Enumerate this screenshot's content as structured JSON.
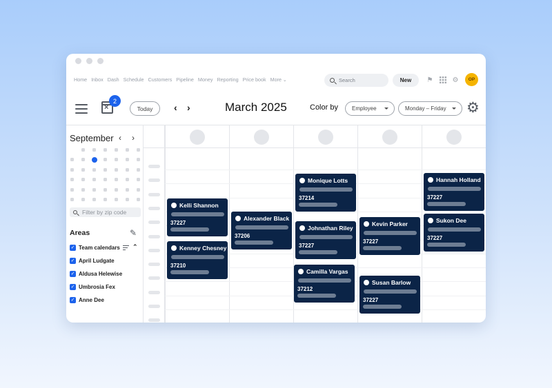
{
  "nav": {
    "items": [
      "Home",
      "Inbox",
      "Dash",
      "Schedule",
      "Customers",
      "Pipeline",
      "Money",
      "Reporting",
      "Price book"
    ],
    "more_label": "More"
  },
  "search": {
    "placeholder": "Search"
  },
  "new_button": {
    "label": "New"
  },
  "user": {
    "initials": "OP",
    "avatar_color": "#f5b400"
  },
  "notification": {
    "count": "2"
  },
  "toolbar": {
    "today_label": "Today",
    "month_title": "March 2025",
    "color_by_label": "Color by",
    "color_by_value": "Employee",
    "range_value": "Monday – Friday"
  },
  "mini_calendar": {
    "month": "September",
    "selected_color": "#1d63ec"
  },
  "filter": {
    "placeholder": "Filter by zip code"
  },
  "areas": {
    "title": "Areas",
    "items": [
      "Team calendars",
      "April Ludgate",
      "Aldusa Helewise",
      "Umbrosia Fex",
      "Anne Dee"
    ]
  },
  "colors": {
    "event_bg": "#0b2447",
    "accent": "#1d63ec"
  },
  "events": [
    {
      "name": "Kelli Shannon",
      "zip": "37227"
    },
    {
      "name": "Kenney Chesney",
      "zip": "37210"
    },
    {
      "name": "Alexander Black",
      "zip": "37206"
    },
    {
      "name": "Monique Lotts",
      "zip": "37214"
    },
    {
      "name": "Johnathan Riley",
      "zip": "37227"
    },
    {
      "name": "Camilla Vargas",
      "zip": "37212"
    },
    {
      "name": "Kevin Parker",
      "zip": "37227"
    },
    {
      "name": "Susan Barlow",
      "zip": "37227"
    },
    {
      "name": "Hannah Holland",
      "zip": "37227"
    },
    {
      "name": "Sukon Dee",
      "zip": "37227"
    }
  ]
}
